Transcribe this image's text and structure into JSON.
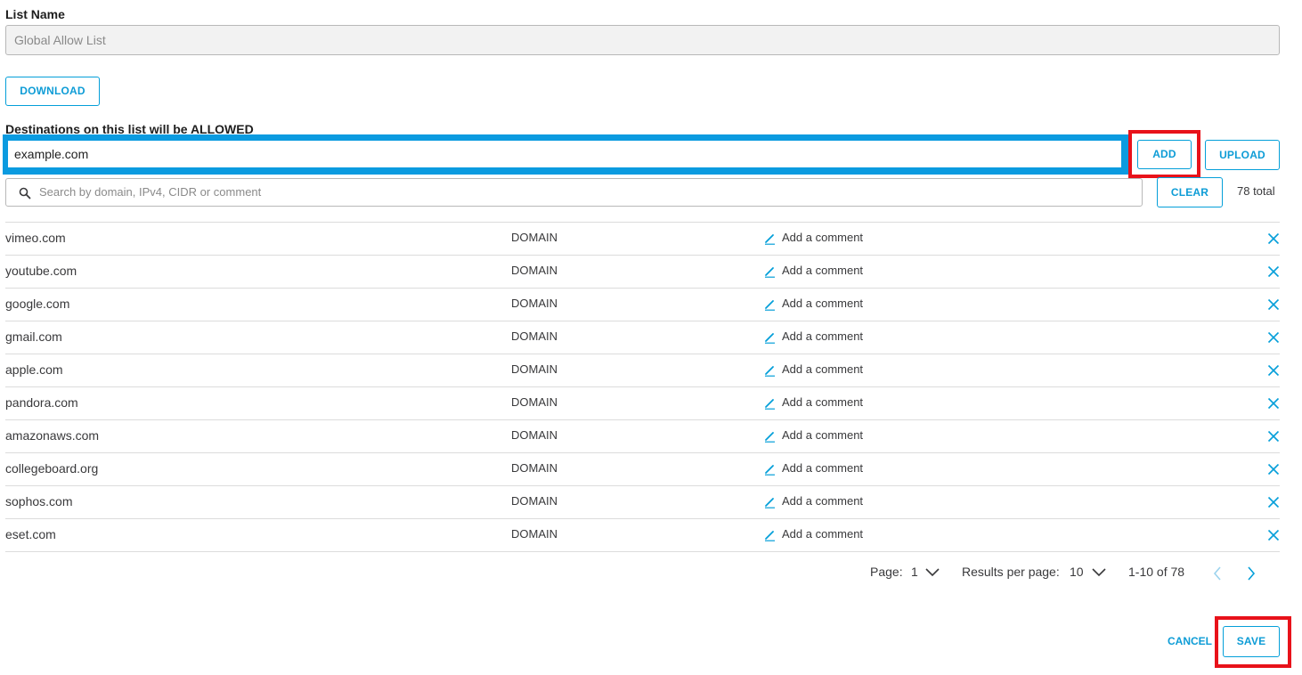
{
  "form": {
    "list_name_label": "List Name",
    "list_name_value": "Global Allow List",
    "download_label": "DOWNLOAD",
    "destinations_label": "Destinations on this list will be ALLOWED",
    "destination_input_value": "example.com",
    "add_label": "ADD",
    "upload_label": "UPLOAD",
    "search_placeholder": "Search by domain, IPv4, CIDR or comment",
    "clear_label": "CLEAR",
    "total_text": "78 total"
  },
  "table": {
    "comment_placeholder": "Add a comment",
    "rows": [
      {
        "destination": "vimeo.com",
        "type": "DOMAIN",
        "comment": "Add a comment"
      },
      {
        "destination": "youtube.com",
        "type": "DOMAIN",
        "comment": "Add a comment"
      },
      {
        "destination": "google.com",
        "type": "DOMAIN",
        "comment": "Add a comment"
      },
      {
        "destination": "gmail.com",
        "type": "DOMAIN",
        "comment": "Add a comment"
      },
      {
        "destination": "apple.com",
        "type": "DOMAIN",
        "comment": "Add a comment"
      },
      {
        "destination": "pandora.com",
        "type": "DOMAIN",
        "comment": "Add a comment"
      },
      {
        "destination": "amazonaws.com",
        "type": "DOMAIN",
        "comment": "Add a comment"
      },
      {
        "destination": "collegeboard.org",
        "type": "DOMAIN",
        "comment": "Add a comment"
      },
      {
        "destination": "sophos.com",
        "type": "DOMAIN",
        "comment": "Add a comment"
      },
      {
        "destination": "eset.com",
        "type": "DOMAIN",
        "comment": "Add a comment"
      }
    ]
  },
  "pagination": {
    "page_label": "Page:",
    "page_value": "1",
    "results_label": "Results per page:",
    "results_value": "10",
    "range_text": "1-10 of 78"
  },
  "footer": {
    "cancel_label": "CANCEL",
    "save_label": "SAVE"
  },
  "icons": {
    "search": "search-icon",
    "edit": "pencil-icon",
    "remove": "close-icon",
    "dropdown": "chevron-down-icon",
    "prev": "chevron-left-icon",
    "next": "chevron-right-icon"
  },
  "colors": {
    "accent": "#049fd9",
    "focus_frame": "#0b9be0",
    "highlight": "#e8121a",
    "text": "#39393b"
  }
}
